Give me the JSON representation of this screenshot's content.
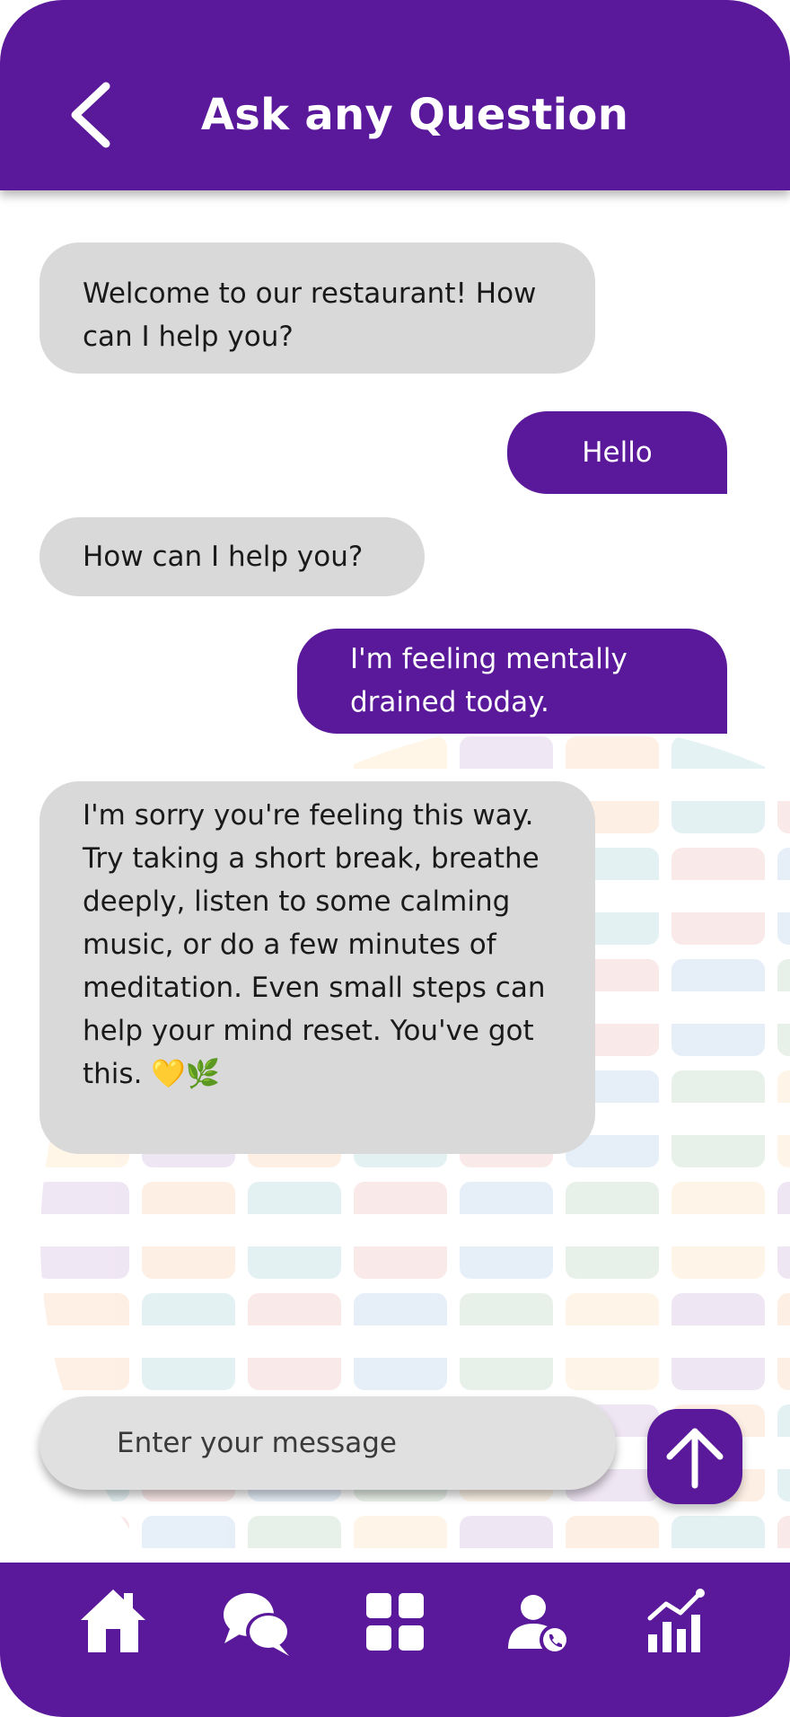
{
  "header": {
    "title": "Ask any Question",
    "back_icon": "chevron-left-icon"
  },
  "messages": [
    {
      "sender": "bot",
      "text": "Welcome to our restaurant! How can I help you?"
    },
    {
      "sender": "user",
      "text": "Hello"
    },
    {
      "sender": "bot",
      "text": "How can I help you?"
    },
    {
      "sender": "user",
      "text": "I'm feeling mentally drained today."
    },
    {
      "sender": "bot",
      "text": "I'm sorry you're feeling this way. Try taking a short break, breathe deeply, listen to some calming music, or do a few minutes of meditation. Even small steps can help your mind reset. You've got this. 💛🌿"
    }
  ],
  "composer": {
    "placeholder": "Enter your message",
    "send_icon": "arrow-up-icon"
  },
  "bottom_nav": {
    "items": [
      {
        "icon": "home-icon"
      },
      {
        "icon": "chat-bubbles-icon"
      },
      {
        "icon": "grid-icon"
      },
      {
        "icon": "user-call-icon"
      },
      {
        "icon": "stats-icon"
      }
    ]
  },
  "colors": {
    "primary": "#5a189a",
    "bot_bubble": "#d9d9d9",
    "background": "#ffffff"
  }
}
